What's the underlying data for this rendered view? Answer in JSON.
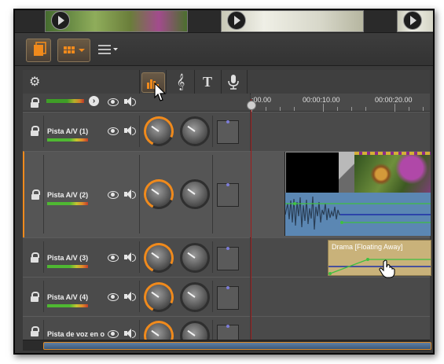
{
  "colors": {
    "accent": "#f08a1c",
    "playhead": "#a31b1b",
    "audio_wave": "#5f8fba",
    "clip_gold": "#c9b27a",
    "envelope": "#3fc040"
  },
  "icons": {
    "video_tab": "video-bars-icon",
    "music_tab": "music-note-icon",
    "title_tab": "text-T-icon",
    "voice_tab": "microphone-icon",
    "settings": "gear-icon",
    "lock": "lock-icon",
    "visibility": "eye-icon",
    "audio": "speaker-icon"
  },
  "ruler": {
    "labels": [
      ":00.00",
      "00:00:10.00",
      "00:00:20.00"
    ]
  },
  "tracks": [
    {
      "name": "Pista A/V (1)"
    },
    {
      "name": "Pista A/V (2)"
    },
    {
      "name": "Pista A/V (3)"
    },
    {
      "name": "Pista A/V (4)"
    },
    {
      "name": "Pista de voz en o"
    }
  ],
  "clips": {
    "audio_clip_title": "Drama [Floating Away]"
  }
}
